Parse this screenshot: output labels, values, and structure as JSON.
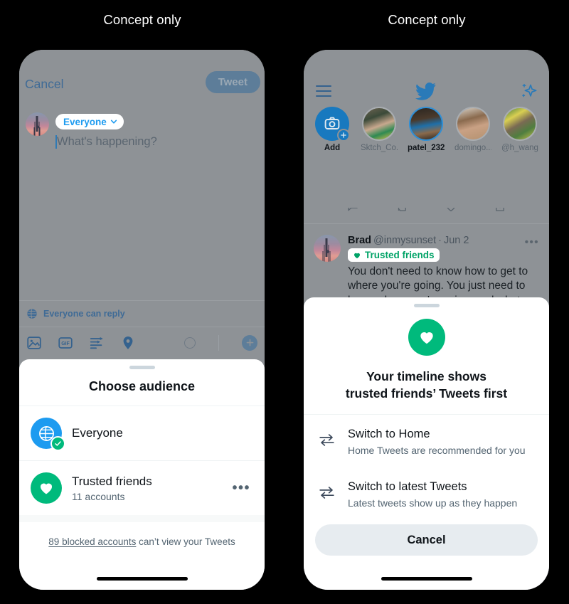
{
  "panels": {
    "left_caption": "Concept only",
    "right_caption": "Concept only"
  },
  "compose": {
    "cancel_label": "Cancel",
    "tweet_label": "Tweet",
    "audience_chip": "Everyone",
    "placeholder": "What's happening?",
    "reply_setting": "Everyone can reply",
    "toolbar_icons": [
      "image-icon",
      "gif-icon",
      "poll-icon",
      "location-icon",
      "progress-ring-icon",
      "add-icon"
    ]
  },
  "audience_sheet": {
    "title": "Choose audience",
    "options": [
      {
        "name": "Everyone",
        "sub": "",
        "icon": "globe-icon",
        "color": "#1D9BF0",
        "selected": true
      },
      {
        "name": "Trusted friends",
        "sub": "11 accounts",
        "icon": "heart-icon",
        "color": "#00BA7C",
        "selected": false
      }
    ],
    "footer_link": "89 blocked accounts",
    "footer_rest": " can’t view your Tweets",
    "overflow_label": "•••"
  },
  "timeline": {
    "header": {
      "menu_icon": "hamburger-icon",
      "logo_icon": "twitter-bird-icon",
      "sparkle_icon": "sparkle-icon"
    },
    "stories": [
      {
        "label": "Add",
        "type": "add"
      },
      {
        "label": "Sktch_Co...",
        "type": "avatar"
      },
      {
        "label": "patel_232",
        "type": "avatar",
        "active": true
      },
      {
        "label": "domingo...",
        "type": "avatar"
      },
      {
        "label": "@h_wang...",
        "type": "avatar"
      },
      {
        "label": "",
        "type": "avatar"
      }
    ],
    "tweet": {
      "name": "Brad",
      "handle": "@inmysunset",
      "separator": "·",
      "date": "Jun 2",
      "badge": "Trusted friends",
      "body": "You don't need to know how to get to where you're going. You just need to know where you're going, and what a good next move is.",
      "overflow_label": "•••",
      "actions": [
        "reply-icon",
        "retweet-icon",
        "like-icon",
        "share-icon"
      ]
    }
  },
  "timeline_sheet": {
    "icon": "heart-icon",
    "title_line1": "Your timeline shows",
    "title_line2": "trusted friends’ Tweets first",
    "options": [
      {
        "title": "Switch to Home",
        "sub": "Home Tweets are recommended for you",
        "icon": "swap-icon"
      },
      {
        "title": "Switch to latest Tweets",
        "sub": "Latest tweets show up as they happen",
        "icon": "swap-icon"
      }
    ],
    "cancel_label": "Cancel"
  },
  "colors": {
    "twitter_blue": "#1D9BF0",
    "green": "#00BA7C",
    "dim_overlay": "#8E9296",
    "page_bg": "#000000"
  }
}
